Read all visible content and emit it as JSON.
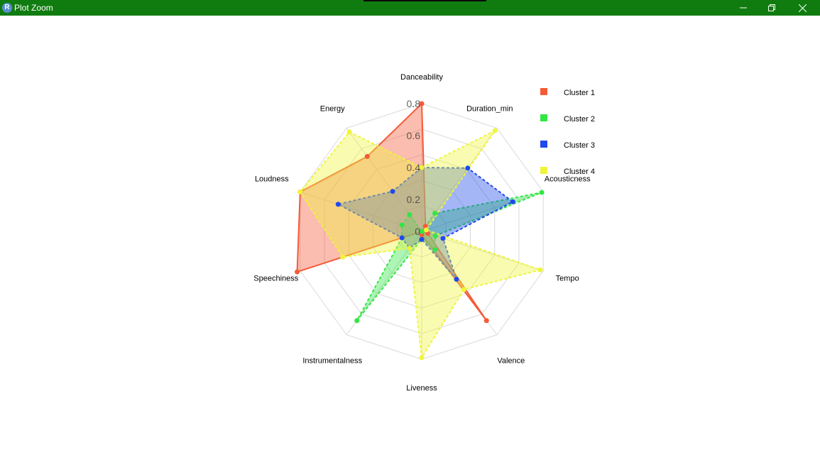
{
  "window": {
    "title": "Plot Zoom",
    "icon_letter": "R",
    "minimize_icon": "minimize-icon",
    "maximize_icon": "restore-icon",
    "close_icon": "close-icon"
  },
  "chart_data": {
    "type": "radar",
    "title": "",
    "axes": [
      "Danceability",
      "Duration_min",
      "Acousticness",
      "Tempo",
      "Valence",
      "Liveness",
      "Instrumentalness",
      "Speechiness",
      "Loudness",
      "Energy"
    ],
    "radial_ticks": [
      "0",
      "0.2",
      "0.4",
      "0.6",
      "0.8"
    ],
    "radial_range": [
      0,
      0.8
    ],
    "grid": true,
    "legend_position": "top-right",
    "series": [
      {
        "name": "Cluster 1",
        "color": "#f55a38",
        "values": [
          0.8,
          0.04,
          0.0,
          0.04,
          0.69,
          0.02,
          0.0,
          0.82,
          0.8,
          0.58
        ]
      },
      {
        "name": "Cluster 2",
        "color": "#32e645",
        "values": [
          0.0,
          0.14,
          0.79,
          0.09,
          0.14,
          0.05,
          0.69,
          0.13,
          0.13,
          0.13
        ]
      },
      {
        "name": "Cluster 3",
        "color": "#1f49ec",
        "values": [
          0.4,
          0.49,
          0.6,
          0.14,
          0.37,
          0.05,
          0.13,
          0.13,
          0.55,
          0.31
        ]
      },
      {
        "name": "Cluster 4",
        "color": "#eef53a",
        "values": [
          0.4,
          0.78,
          0.03,
          0.78,
          0.45,
          0.79,
          0.13,
          0.52,
          0.8,
          0.77
        ]
      }
    ]
  }
}
